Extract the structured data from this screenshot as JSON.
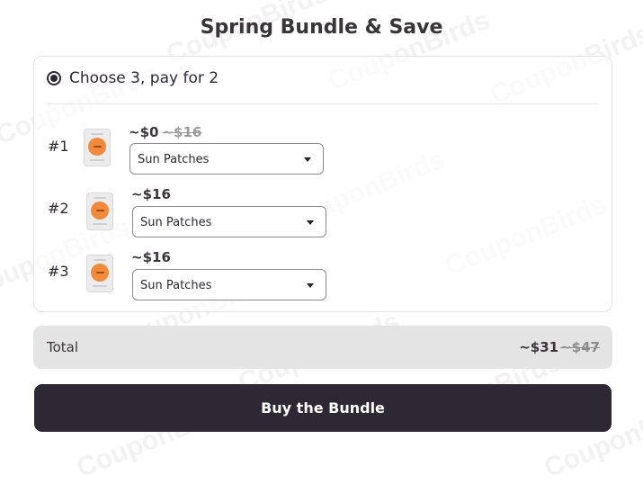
{
  "watermark": "CouponBirds",
  "title": "Spring Bundle & Save",
  "option": {
    "label": "Choose 3, pay for 2",
    "selected": true
  },
  "items": [
    {
      "number": "#1",
      "price": "~$0",
      "old_price": "~$16",
      "product": "Sun Patches"
    },
    {
      "number": "#2",
      "price": "~$16",
      "old_price": "",
      "product": "Sun Patches"
    },
    {
      "number": "#3",
      "price": "~$16",
      "old_price": "",
      "product": "Sun Patches"
    }
  ],
  "total": {
    "label": "Total",
    "price": "~$31",
    "old_price": "~$47"
  },
  "buy_button": "Buy the Bundle",
  "colors": {
    "primary": "#2d2833",
    "product_accent": "#f28a3c",
    "total_bg": "#e4e4e4"
  }
}
